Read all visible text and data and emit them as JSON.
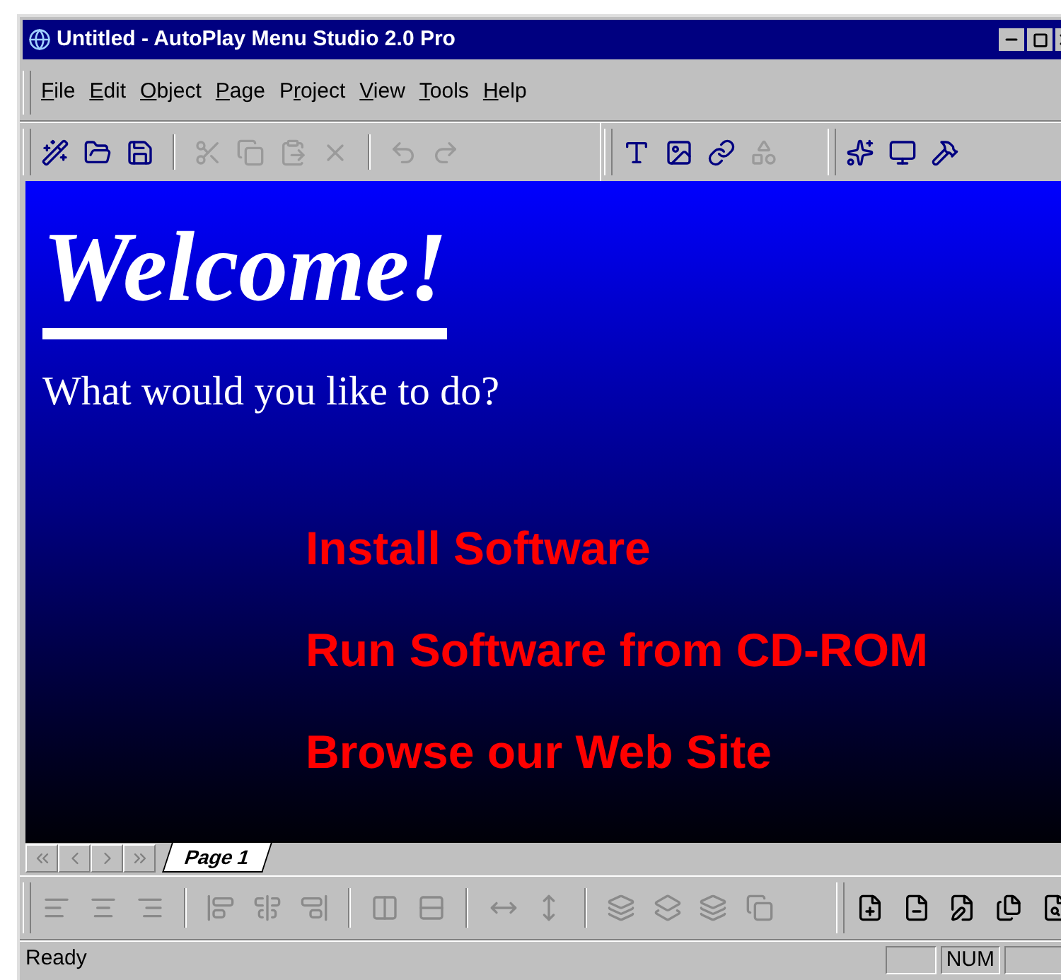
{
  "window": {
    "title": "Untitled - AutoPlay Menu Studio 2.0 Pro"
  },
  "menu": [
    {
      "label": "File"
    },
    {
      "label": "Edit"
    },
    {
      "label": "Object"
    },
    {
      "label": "Page"
    },
    {
      "label": "Project"
    },
    {
      "label": "View"
    },
    {
      "label": "Tools"
    },
    {
      "label": "Help"
    }
  ],
  "toolbar": {
    "groups": [
      [
        {
          "disabled": false
        },
        {
          "disabled": false
        },
        {
          "disabled": false
        }
      ],
      [
        {
          "disabled": true
        },
        {
          "disabled": true
        },
        {
          "disabled": true
        },
        {
          "disabled": true
        }
      ],
      [
        {
          "disabled": true
        },
        {
          "disabled": true
        }
      ]
    ],
    "objects": [
      {
        "disabled": false
      },
      {
        "disabled": false
      },
      {
        "disabled": false
      },
      {
        "disabled": true
      }
    ],
    "tools": [
      {
        "disabled": false
      },
      {
        "disabled": false
      },
      {
        "disabled": false
      }
    ]
  },
  "page": {
    "heading": "Welcome!",
    "subheading": "What would you like to do?",
    "links": [
      "Install Software",
      "Run Software from CD-ROM",
      "Browse our Web Site"
    ]
  },
  "tabs": [
    {
      "label": "Page 1",
      "selected": true
    }
  ],
  "status_bar": {
    "text": "Ready",
    "indicators": [
      {
        "label": "NUM"
      }
    ]
  }
}
